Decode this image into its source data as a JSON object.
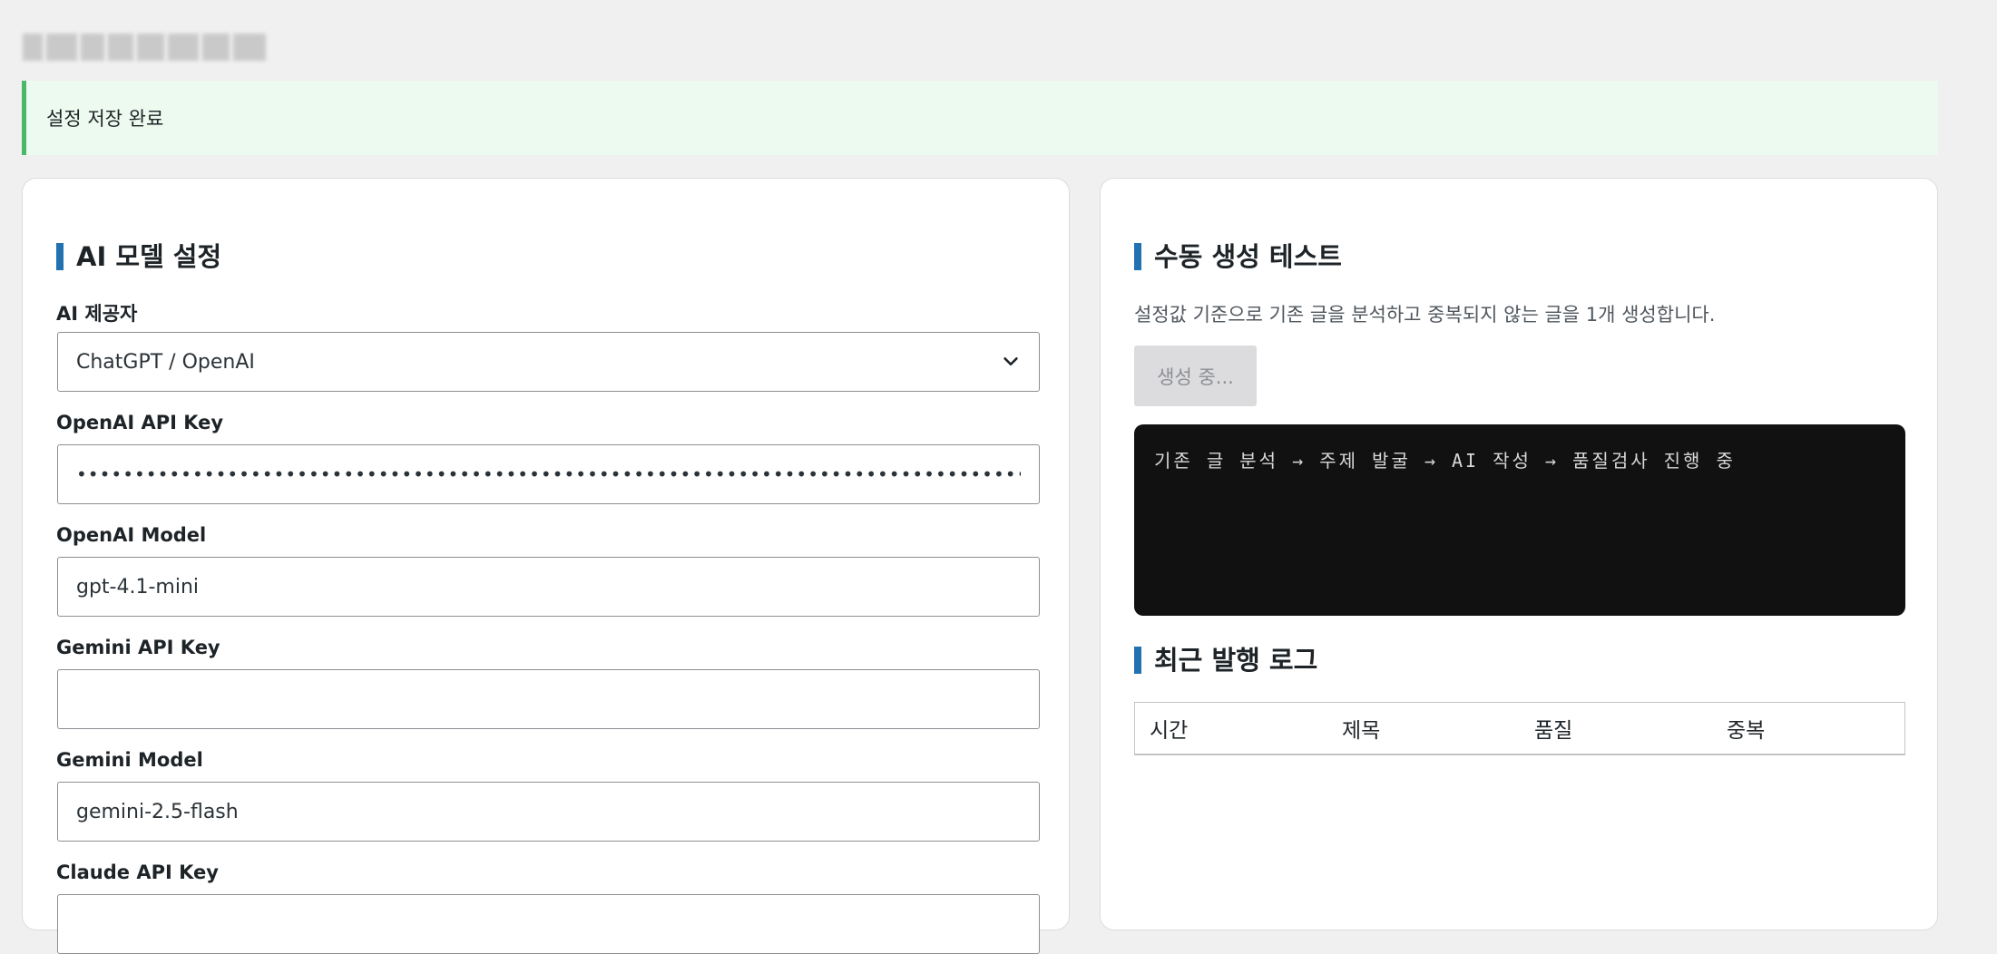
{
  "notice": {
    "message": "설정 저장 완료"
  },
  "left_card": {
    "title": "AI 모델 설정",
    "fields": {
      "provider": {
        "label": "AI 제공자",
        "value": "ChatGPT / OpenAI"
      },
      "openai_key": {
        "label": "OpenAI API Key",
        "value": "••••••••••••••••••••••••••••••••••••••••••••••••••••••••••••••••••••••••••••••••••••••••••••"
      },
      "openai_model": {
        "label": "OpenAI Model",
        "value": "gpt-4.1-mini"
      },
      "gemini_key": {
        "label": "Gemini API Key",
        "value": ""
      },
      "gemini_model": {
        "label": "Gemini Model",
        "value": "gemini-2.5-flash"
      },
      "claude_key": {
        "label": "Claude API Key",
        "value": ""
      }
    }
  },
  "right_card": {
    "test_title": "수동 생성 테스트",
    "description": "설정값 기준으로 기존 글을 분석하고 중복되지 않는 글을 1개 생성합니다.",
    "generate_button": "생성 중...",
    "console_text": "기존 글 분석 → 주제 발굴 → AI 작성 → 품질검사 진행 중",
    "log_title": "최근 발행 로그",
    "log_columns": [
      "시간",
      "제목",
      "품질",
      "중복"
    ]
  },
  "colors": {
    "accent": "#2271b1",
    "success": "#4ab866",
    "console_bg": "#111111"
  }
}
